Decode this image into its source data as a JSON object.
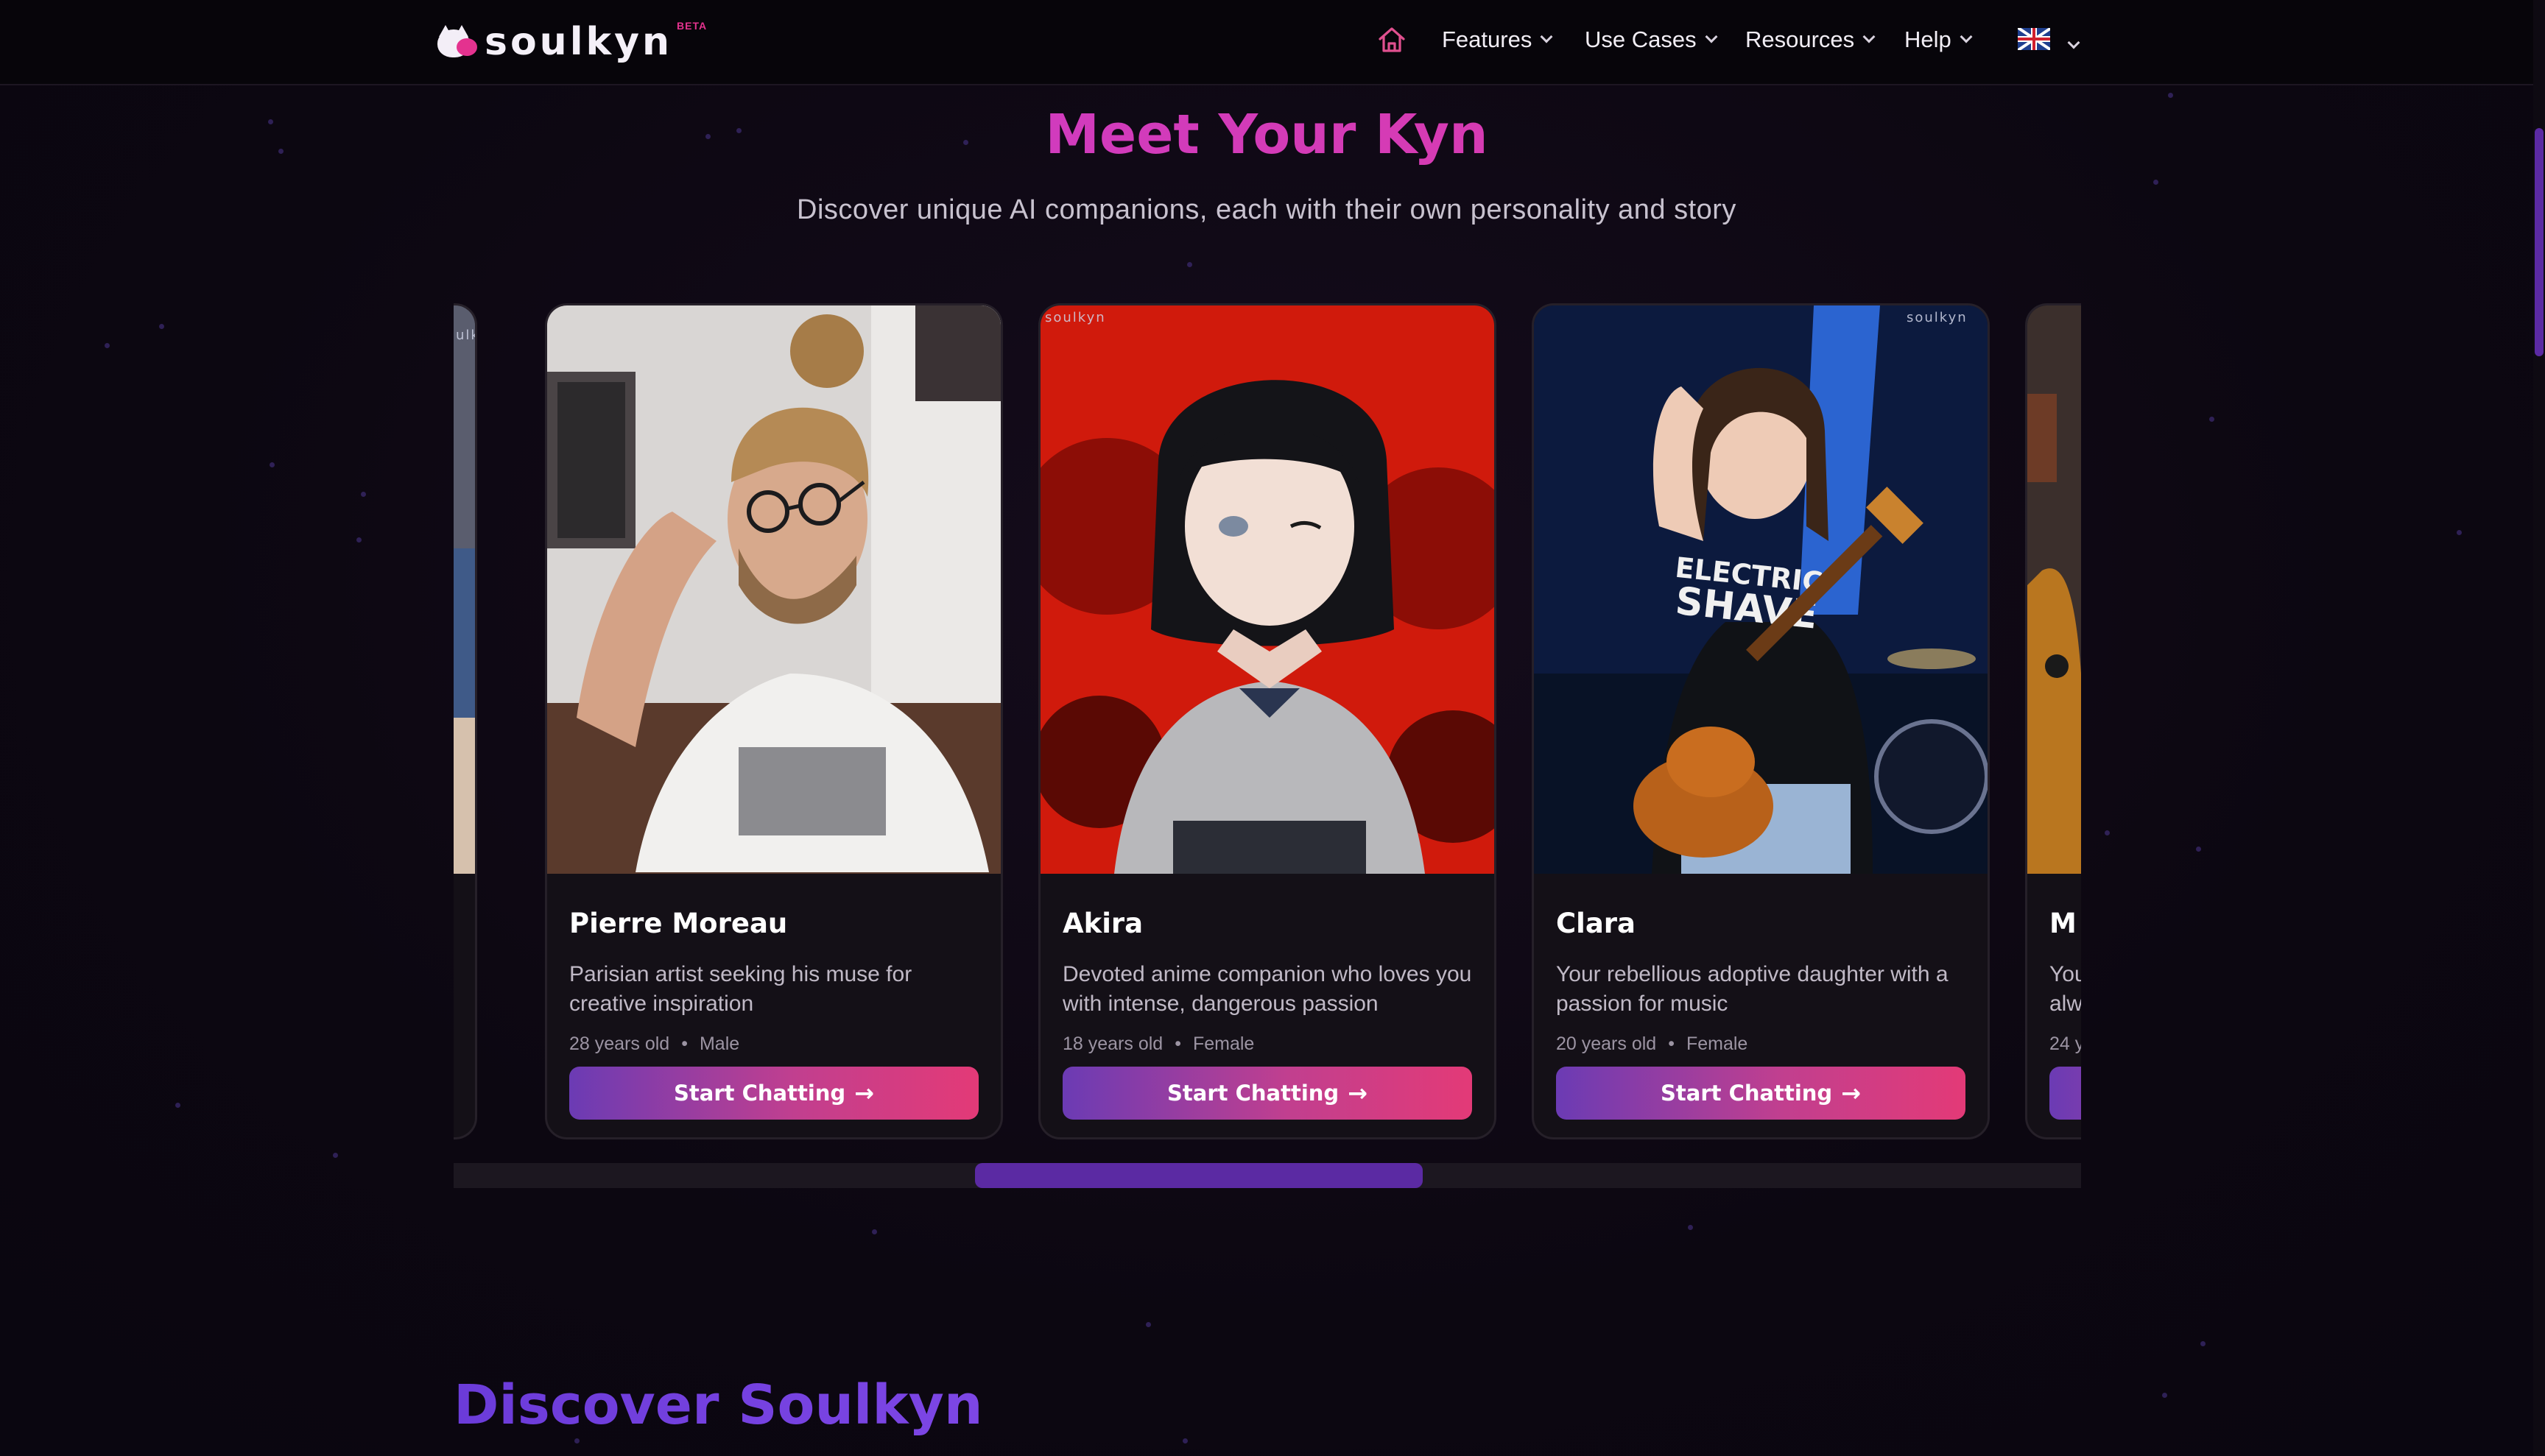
{
  "header": {
    "brand": "soulkyn",
    "beta_badge": "BETA",
    "nav": [
      {
        "label": "Features"
      },
      {
        "label": "Use Cases"
      },
      {
        "label": "Resources"
      },
      {
        "label": "Help"
      }
    ],
    "home_icon": "home-icon",
    "language_icon": "uk-flag-icon"
  },
  "hero": {
    "title": "Meet Your Kyn",
    "subtitle": "Discover unique AI companions, each with their own personality and story"
  },
  "watermark": "soulkyn",
  "cards": [
    {
      "name": "Pierre Moreau",
      "description": "Parisian artist seeking his muse for creative inspiration",
      "age": "28 years old",
      "gender": "Male",
      "cta": "Start Chatting"
    },
    {
      "name": "Akira",
      "description": "Devoted anime companion who loves you with intense, dangerous passion",
      "age": "18 years old",
      "gender": "Female",
      "cta": "Start Chatting"
    },
    {
      "name": "Clara",
      "description": "Your rebellious adoptive daughter with a passion for music",
      "age": "20 years old",
      "gender": "Female",
      "cta": "Start Chatting"
    }
  ],
  "partial_card_right": {
    "name_fragment": "M",
    "desc_line1": "You",
    "desc_line2": "alw",
    "age_fragment": "24 y"
  },
  "section2": {
    "title": "Discover Soulkyn"
  },
  "colors": {
    "accent_pink": "#e33b9a",
    "accent_purple": "#6b3bd9",
    "background": "#0d0812"
  }
}
